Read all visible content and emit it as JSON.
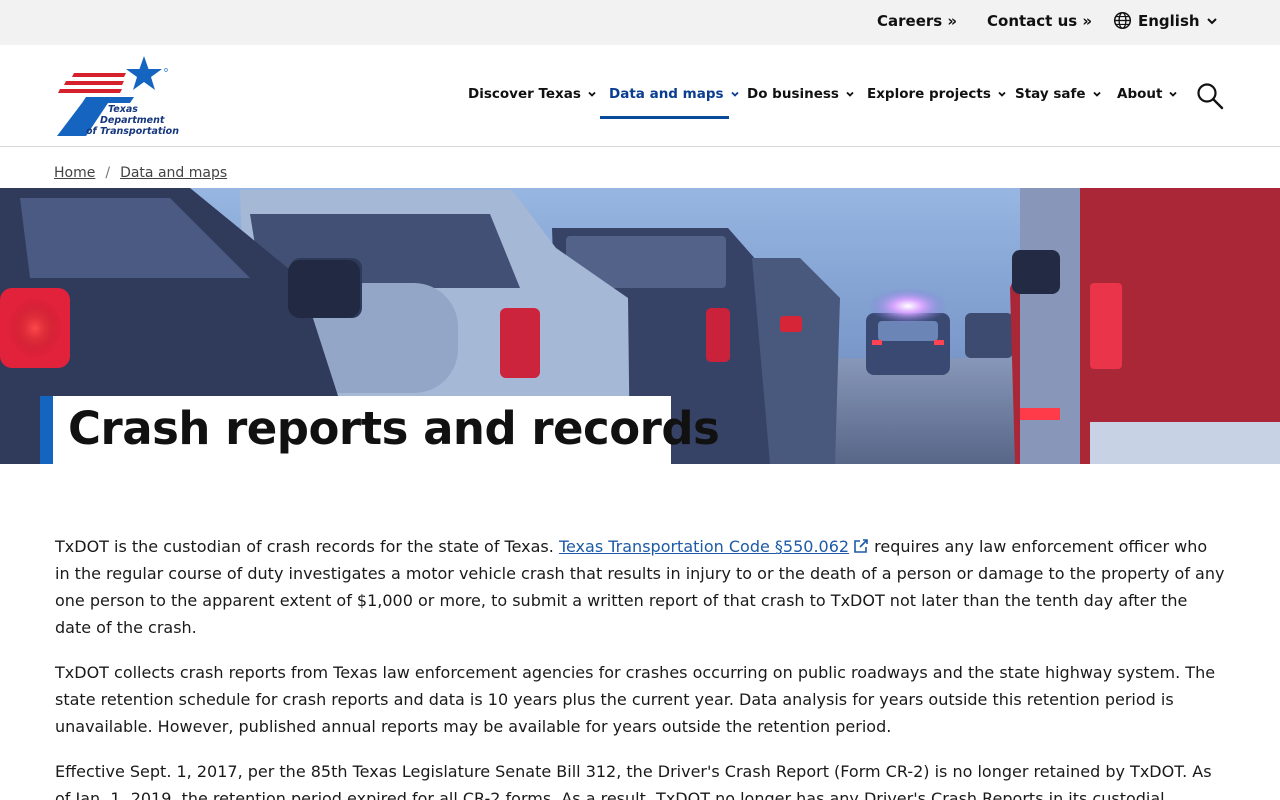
{
  "utility": {
    "careers": "Careers »",
    "contact": "Contact us »",
    "language": "English"
  },
  "logo": {
    "line1": "Texas",
    "line2": "Department",
    "line3": "of Transportation",
    "colors": {
      "navy": "#14377d",
      "red": "#d6202b",
      "blue": "#1565c0"
    }
  },
  "nav": {
    "items": [
      {
        "label": "Discover Texas"
      },
      {
        "label": "Data and maps"
      },
      {
        "label": "Do business"
      },
      {
        "label": "Explore projects"
      },
      {
        "label": "Stay safe"
      },
      {
        "label": "About"
      }
    ],
    "active_index": 1
  },
  "breadcrumb": {
    "home": "Home",
    "separator": "/",
    "current": "Data and maps"
  },
  "page": {
    "title": "Crash reports and records"
  },
  "content": {
    "p1_before": "TxDOT is the custodian of crash records for the state of Texas. ",
    "p1_link": "Texas Transportation Code §550.062",
    "p1_after": " requires any law enforcement officer who in the regular course of duty investigates a motor vehicle crash that results in injury to or the death of a person or damage to the property of any one person to the apparent extent of $1,000 or more, to submit a written report of that crash to TxDOT not later than the tenth day after the date of the crash.",
    "p2": "TxDOT collects crash reports from Texas law enforcement agencies for crashes occurring on public roadways and the state highway system. The state retention schedule for crash reports and data is 10 years plus the current year. Data analysis for years outside this retention period is unavailable. However, published annual reports may be available for years outside the retention period.",
    "p3": "Effective Sept. 1, 2017, per the 85th Texas Legislature Senate Bill 312, the Driver's Crash Report (Form CR-2) is no longer retained by TxDOT. As of Jan. 1, 2019, the retention period expired for all CR-2 forms. As a result, TxDOT no longer has any Driver's Crash Reports in its custodial"
  },
  "colors": {
    "accent": "#1465c0",
    "link": "#1d5aa7",
    "active_nav": "#0a3d8f"
  },
  "icons": {
    "language": "globe-icon",
    "search": "search-icon",
    "external": "external-link-icon",
    "dropdown": "chevron-down-icon"
  }
}
